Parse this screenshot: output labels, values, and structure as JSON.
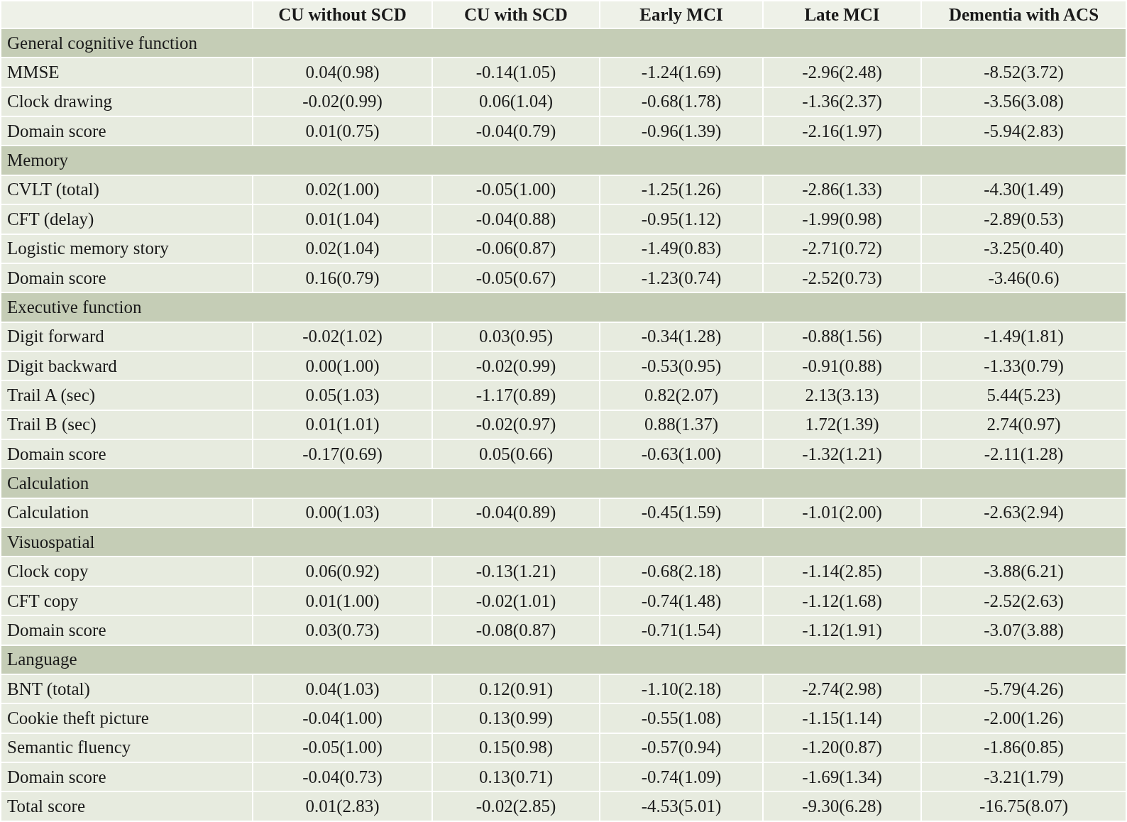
{
  "table": {
    "columns": [
      "",
      "CU without SCD",
      "CU with SCD",
      "Early MCI",
      "Late MCI",
      "Dementia with ACS"
    ],
    "rows": [
      {
        "kind": "section",
        "label": "General cognitive function"
      },
      {
        "kind": "data",
        "label": "MMSE",
        "values": [
          "0.04(0.98)",
          "-0.14(1.05)",
          "-1.24(1.69)",
          "-2.96(2.48)",
          "-8.52(3.72)"
        ]
      },
      {
        "kind": "data",
        "label": "Clock drawing",
        "values": [
          "-0.02(0.99)",
          "0.06(1.04)",
          "-0.68(1.78)",
          "-1.36(2.37)",
          "-3.56(3.08)"
        ]
      },
      {
        "kind": "data",
        "label": "Domain score",
        "values": [
          "0.01(0.75)",
          "-0.04(0.79)",
          "-0.96(1.39)",
          "-2.16(1.97)",
          "-5.94(2.83)"
        ]
      },
      {
        "kind": "section",
        "label": "Memory"
      },
      {
        "kind": "data",
        "label": "CVLT (total)",
        "values": [
          "0.02(1.00)",
          "-0.05(1.00)",
          "-1.25(1.26)",
          "-2.86(1.33)",
          "-4.30(1.49)"
        ]
      },
      {
        "kind": "data",
        "label": "CFT (delay)",
        "values": [
          "0.01(1.04)",
          "-0.04(0.88)",
          "-0.95(1.12)",
          "-1.99(0.98)",
          "-2.89(0.53)"
        ]
      },
      {
        "kind": "data",
        "label": "Logistic memory story",
        "values": [
          "0.02(1.04)",
          "-0.06(0.87)",
          "-1.49(0.83)",
          "-2.71(0.72)",
          "-3.25(0.40)"
        ]
      },
      {
        "kind": "data",
        "label": "Domain score",
        "values": [
          "0.16(0.79)",
          "-0.05(0.67)",
          "-1.23(0.74)",
          "-2.52(0.73)",
          "-3.46(0.6)"
        ]
      },
      {
        "kind": "section",
        "label": "Executive function"
      },
      {
        "kind": "data",
        "label": "Digit forward",
        "values": [
          "-0.02(1.02)",
          "0.03(0.95)",
          "-0.34(1.28)",
          "-0.88(1.56)",
          "-1.49(1.81)"
        ]
      },
      {
        "kind": "data",
        "label": "Digit backward",
        "values": [
          "0.00(1.00)",
          "-0.02(0.99)",
          "-0.53(0.95)",
          "-0.91(0.88)",
          "-1.33(0.79)"
        ]
      },
      {
        "kind": "data",
        "label": "Trail A (sec)",
        "values": [
          "0.05(1.03)",
          "-1.17(0.89)",
          "0.82(2.07)",
          "2.13(3.13)",
          "5.44(5.23)"
        ]
      },
      {
        "kind": "data",
        "label": "Trail B (sec)",
        "values": [
          "0.01(1.01)",
          "-0.02(0.97)",
          "0.88(1.37)",
          "1.72(1.39)",
          "2.74(0.97)"
        ]
      },
      {
        "kind": "data",
        "label": "Domain score",
        "values": [
          "-0.17(0.69)",
          "0.05(0.66)",
          "-0.63(1.00)",
          "-1.32(1.21)",
          "-2.11(1.28)"
        ]
      },
      {
        "kind": "section",
        "label": "Calculation"
      },
      {
        "kind": "data",
        "label": "Calculation",
        "values": [
          "0.00(1.03)",
          "-0.04(0.89)",
          "-0.45(1.59)",
          "-1.01(2.00)",
          "-2.63(2.94)"
        ]
      },
      {
        "kind": "section",
        "label": "Visuospatial"
      },
      {
        "kind": "data",
        "label": "Clock copy",
        "values": [
          "0.06(0.92)",
          "-0.13(1.21)",
          "-0.68(2.18)",
          "-1.14(2.85)",
          "-3.88(6.21)"
        ]
      },
      {
        "kind": "data",
        "label": "CFT copy",
        "values": [
          "0.01(1.00)",
          "-0.02(1.01)",
          "-0.74(1.48)",
          "-1.12(1.68)",
          "-2.52(2.63)"
        ]
      },
      {
        "kind": "data",
        "label": "Domain score",
        "values": [
          "0.03(0.73)",
          "-0.08(0.87)",
          "-0.71(1.54)",
          "-1.12(1.91)",
          "-3.07(3.88)"
        ]
      },
      {
        "kind": "section",
        "label": "Language"
      },
      {
        "kind": "data",
        "label": "BNT (total)",
        "values": [
          "0.04(1.03)",
          "0.12(0.91)",
          "-1.10(2.18)",
          "-2.74(2.98)",
          "-5.79(4.26)"
        ]
      },
      {
        "kind": "data",
        "label": "Cookie theft picture",
        "values": [
          "-0.04(1.00)",
          "0.13(0.99)",
          "-0.55(1.08)",
          "-1.15(1.14)",
          "-2.00(1.26)"
        ]
      },
      {
        "kind": "data",
        "label": "Semantic fluency",
        "values": [
          "-0.05(1.00)",
          "0.15(0.98)",
          "-0.57(0.94)",
          "-1.20(0.87)",
          "-1.86(0.85)"
        ]
      },
      {
        "kind": "data",
        "label": "Domain score",
        "values": [
          "-0.04(0.73)",
          "0.13(0.71)",
          "-0.74(1.09)",
          "-1.69(1.34)",
          "-3.21(1.79)"
        ]
      },
      {
        "kind": "data",
        "label": "Total score",
        "values": [
          "0.01(2.83)",
          "-0.02(2.85)",
          "-4.53(5.01)",
          "-9.30(6.28)",
          "-16.75(8.07)"
        ]
      }
    ]
  }
}
